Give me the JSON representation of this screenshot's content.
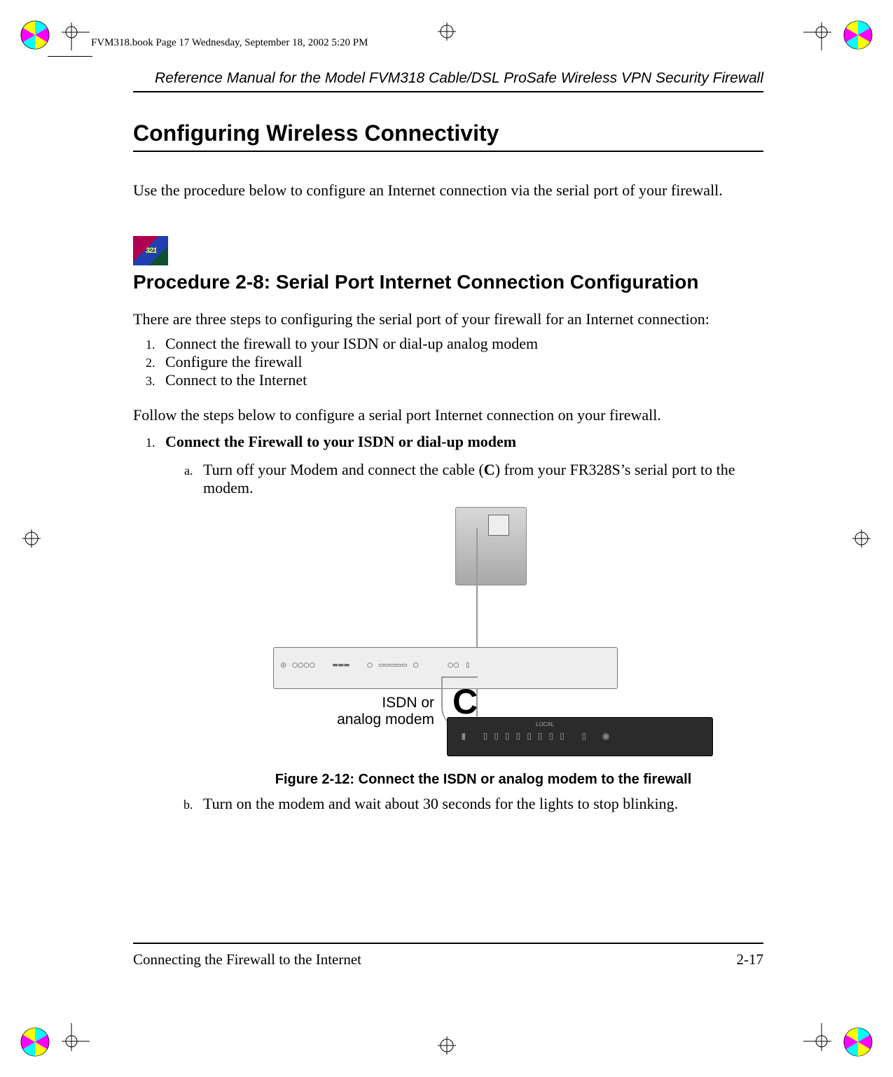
{
  "print_header": "FVM318.book  Page 17  Wednesday, September 18, 2002  5:20 PM",
  "running_head": "Reference Manual for the Model FVM318 Cable/DSL ProSafe Wireless VPN Security Firewall",
  "section_title": "Configuring Wireless Connectivity",
  "intro_para": "Use the procedure below to configure an Internet connection via the serial port of your firewall.",
  "procedure_title": "Procedure 2-8:  Serial Port Internet Connection Configuration",
  "intro_para2": "There are three steps to configuring the serial port of your firewall for an Internet connection:",
  "overview_steps": [
    "Connect the firewall to your ISDN or dial-up analog modem",
    "Configure the firewall",
    "Connect to the Internet"
  ],
  "follow_para": "Follow the steps below to configure a serial port Internet connection on your firewall.",
  "step1_title": "Connect the Firewall to your ISDN or dial-up modem",
  "step1a_pre": "Turn off your Modem and connect the cable (",
  "step1a_bold": "C",
  "step1a_post": ") from your FR328S’s serial port to the modem.",
  "figure_label_line1": "ISDN or",
  "figure_label_line2": "analog modem",
  "figure_letter": "C",
  "router_ports_label": "LOCAL",
  "figure_caption": "Figure 2-12: Connect the ISDN or analog modem to the firewall",
  "step1b": "Turn on the modem and wait about 30 seconds for the lights to stop blinking.",
  "footer_left": "Connecting the Firewall to the Internet",
  "footer_right": "2-17"
}
